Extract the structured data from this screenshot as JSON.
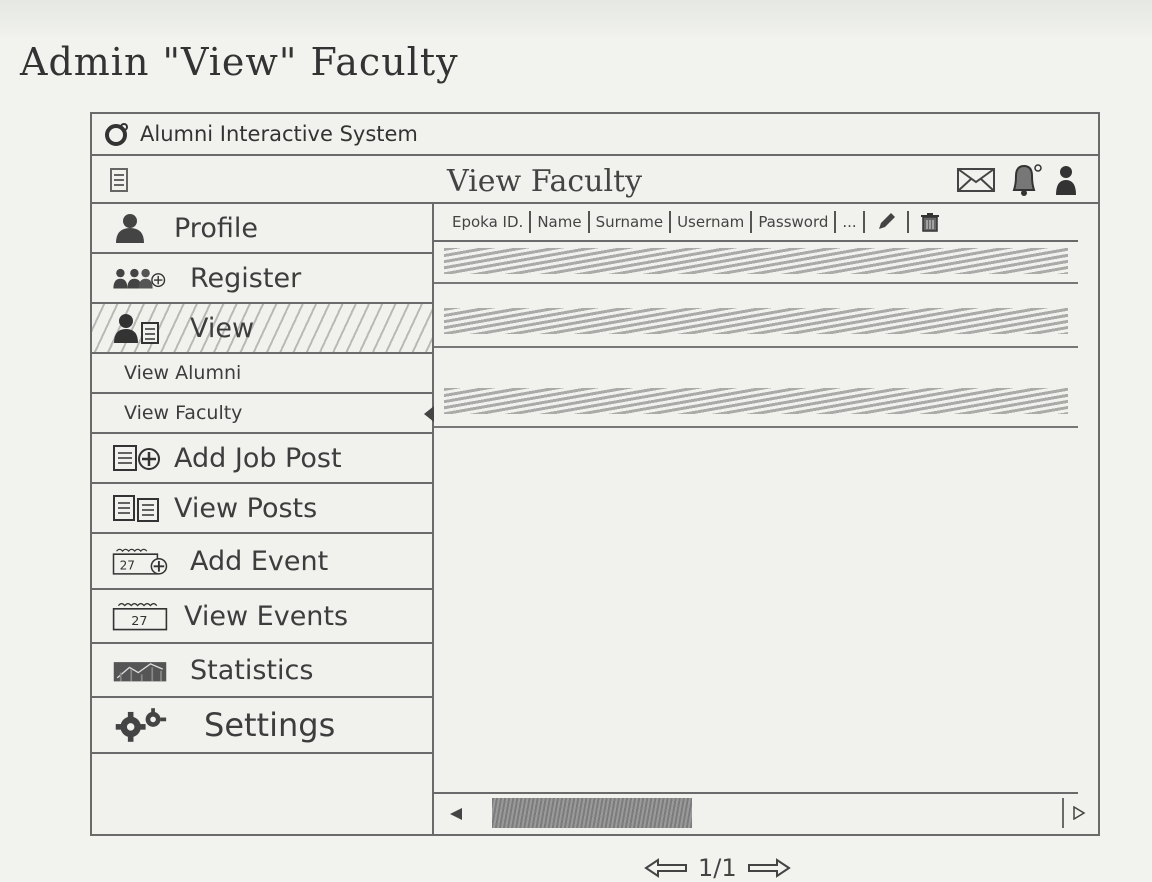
{
  "page_heading": "Admin \"View\" Faculty",
  "app": {
    "title": "Alumni Interactive System"
  },
  "header": {
    "title": "View Faculty"
  },
  "sidebar": {
    "items": [
      {
        "label": "Profile",
        "icon": "user-icon"
      },
      {
        "label": "Register",
        "icon": "add-users-icon"
      },
      {
        "label": "View",
        "icon": "user-list-icon"
      },
      {
        "label": "Add Job Post",
        "icon": "add-post-icon"
      },
      {
        "label": "View Posts",
        "icon": "posts-icon"
      },
      {
        "label": "Add Event",
        "icon": "add-calendar-icon"
      },
      {
        "label": "View Events",
        "icon": "calendar-icon"
      },
      {
        "label": "Statistics",
        "icon": "statistics-icon"
      },
      {
        "label": "Settings",
        "icon": "gear-icon"
      }
    ],
    "view_subitems": [
      {
        "label": "View Alumni"
      },
      {
        "label": "View Faculty"
      }
    ]
  },
  "table": {
    "columns": [
      "Epoka ID.",
      "Name",
      "Surname",
      "Usernam",
      "Password",
      "..."
    ],
    "rows": 3
  },
  "pagination": {
    "text": "1/1"
  },
  "colors": {
    "ink": "#3a3a3a",
    "paper": "#f2f3ef"
  }
}
